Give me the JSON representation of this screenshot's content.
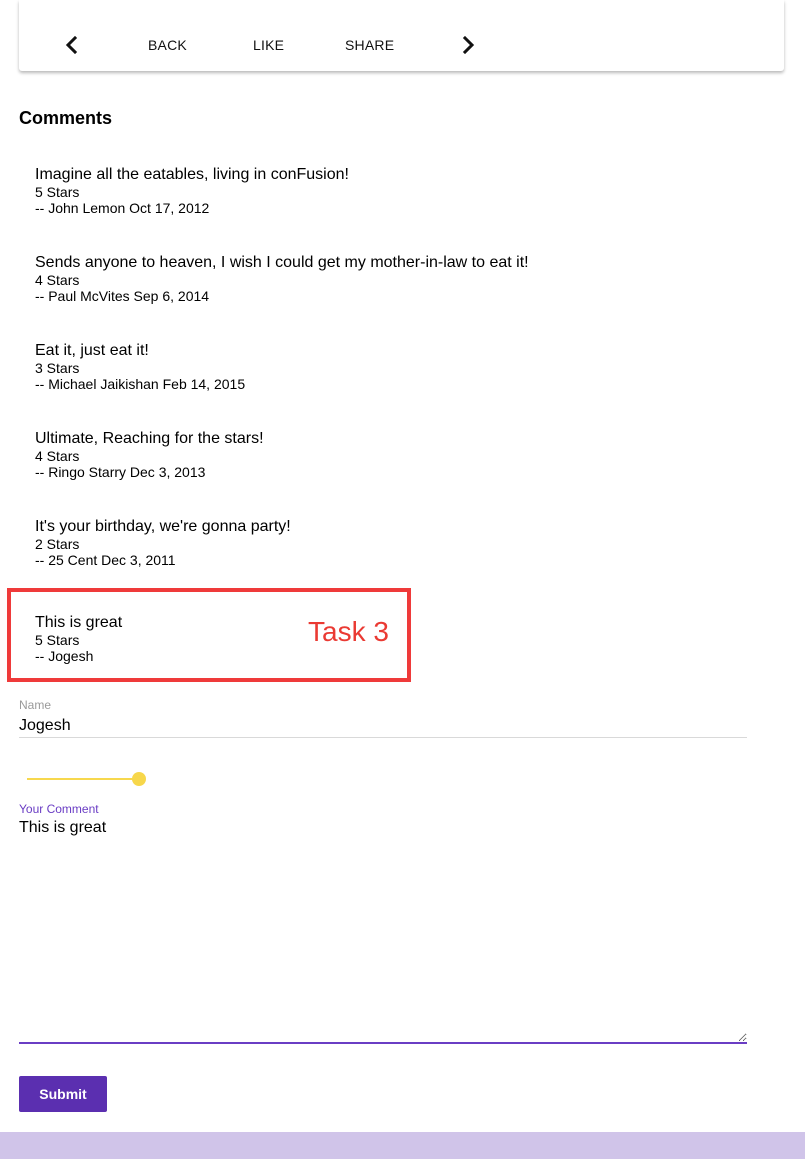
{
  "card_actions": {
    "back_label": "BACK",
    "like_label": "LIKE",
    "share_label": "SHARE"
  },
  "icons": {
    "prev": "chevron-left-icon",
    "next": "chevron-right-icon"
  },
  "comments_section": {
    "title": "Comments",
    "items": [
      {
        "text": "Imagine all the eatables, living in conFusion!",
        "rating": "5 Stars",
        "byline": "-- John Lemon Oct 17, 2012"
      },
      {
        "text": "Sends anyone to heaven, I wish I could get my mother-in-law to eat it!",
        "rating": "4 Stars",
        "byline": "-- Paul McVites Sep 6, 2014"
      },
      {
        "text": "Eat it, just eat it!",
        "rating": "3 Stars",
        "byline": "-- Michael Jaikishan Feb 14, 2015"
      },
      {
        "text": "Ultimate, Reaching for the stars!",
        "rating": "4 Stars",
        "byline": "-- Ringo Starry Dec 3, 2013"
      },
      {
        "text": "It's your birthday, we're gonna party!",
        "rating": "2 Stars",
        "byline": "-- 25 Cent Dec 3, 2011"
      },
      {
        "text": "This is great",
        "rating": "5 Stars",
        "byline": "-- Jogesh"
      }
    ]
  },
  "annotation": {
    "label": "Task 3",
    "color": "#ea3a33"
  },
  "form": {
    "name_label": "Name",
    "name_value": "Jogesh",
    "rating_slider_value": 5,
    "comment_label": "Your Comment",
    "comment_value": "This is great",
    "submit_label": "Submit"
  },
  "colors": {
    "accent": "#6a3dc4",
    "submit_bg": "#5b2fb0",
    "slider": "#f7d84e",
    "footer_band": "#d0c4e9"
  }
}
